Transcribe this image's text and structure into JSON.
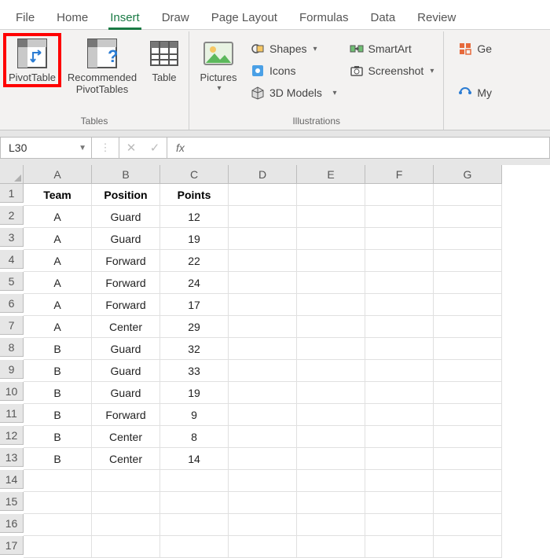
{
  "tabs": {
    "file": "File",
    "home": "Home",
    "insert": "Insert",
    "draw": "Draw",
    "pagelayout": "Page Layout",
    "formulas": "Formulas",
    "data": "Data",
    "review": "Review"
  },
  "ribbon": {
    "tables": {
      "label": "Tables",
      "pivottable": "PivotTable",
      "recommended": "Recommended PivotTables",
      "table": "Table"
    },
    "illustrations": {
      "label": "Illustrations",
      "pictures": "Pictures",
      "shapes": "Shapes",
      "icons": "Icons",
      "models3d": "3D Models",
      "smartart": "SmartArt",
      "screenshot": "Screenshot"
    },
    "right": {
      "get": "Ge",
      "my": "My"
    }
  },
  "namebox": "L30",
  "fx_label": "fx",
  "formula": "",
  "col_headers": [
    "A",
    "B",
    "C",
    "D",
    "E",
    "F",
    "G"
  ],
  "row_headers": [
    "1",
    "2",
    "3",
    "4",
    "5",
    "6",
    "7",
    "8",
    "9",
    "10",
    "11",
    "12",
    "13",
    "14",
    "15",
    "16",
    "17"
  ],
  "sheet": {
    "header": {
      "a": "Team",
      "b": "Position",
      "c": "Points"
    },
    "rows": [
      {
        "a": "A",
        "b": "Guard",
        "c": "12"
      },
      {
        "a": "A",
        "b": "Guard",
        "c": "19"
      },
      {
        "a": "A",
        "b": "Forward",
        "c": "22"
      },
      {
        "a": "A",
        "b": "Forward",
        "c": "24"
      },
      {
        "a": "A",
        "b": "Forward",
        "c": "17"
      },
      {
        "a": "A",
        "b": "Center",
        "c": "29"
      },
      {
        "a": "B",
        "b": "Guard",
        "c": "32"
      },
      {
        "a": "B",
        "b": "Guard",
        "c": "33"
      },
      {
        "a": "B",
        "b": "Guard",
        "c": "19"
      },
      {
        "a": "B",
        "b": "Forward",
        "c": "9"
      },
      {
        "a": "B",
        "b": "Center",
        "c": "8"
      },
      {
        "a": "B",
        "b": "Center",
        "c": "14"
      }
    ]
  }
}
